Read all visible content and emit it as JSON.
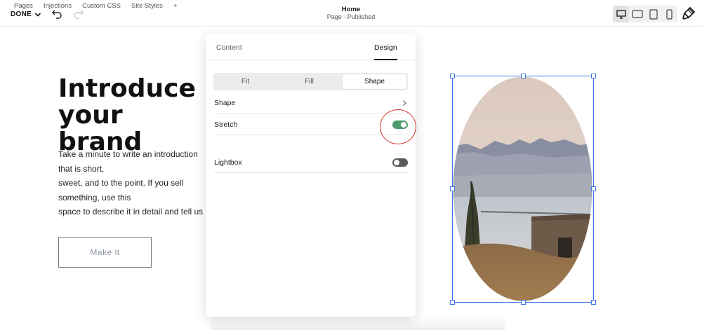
{
  "top_bar": {
    "tabs": [
      "Pages",
      "Injections",
      "Custom CSS",
      "Site Styles"
    ],
    "add_label": "+",
    "done_label": "DONE",
    "page_title": "Home",
    "page_status": "Page · Published",
    "devices": [
      "desktop-icon",
      "tablet-landscape-icon",
      "tablet-portrait-icon",
      "mobile-icon"
    ],
    "active_device": "desktop"
  },
  "content": {
    "headline": "Introduce your\nbrand",
    "body": "Take a minute to write an introduction that is short,\nsweet, and to the point. If you sell something, use this\nspace to describe it in detail and tell us why we\nshould make a purchase. Tap into your creativity.\nYou've got this.",
    "cta_label": "Make it"
  },
  "panel": {
    "tabs": {
      "content": "Content",
      "design": "Design"
    },
    "active_tab": "Design",
    "segments": [
      "Fit",
      "Fill",
      "Shape"
    ],
    "active_segment": "Shape",
    "rows": {
      "shape": "Shape",
      "stretch": "Stretch",
      "lightbox": "Lightbox"
    },
    "stretch_enabled": true,
    "lightbox_enabled": false
  },
  "colors": {
    "toggle_on": "#4e9a6a",
    "toggle_off": "#5a5a5a",
    "selection": "#3b78e7",
    "highlight": "#d63a2a"
  }
}
